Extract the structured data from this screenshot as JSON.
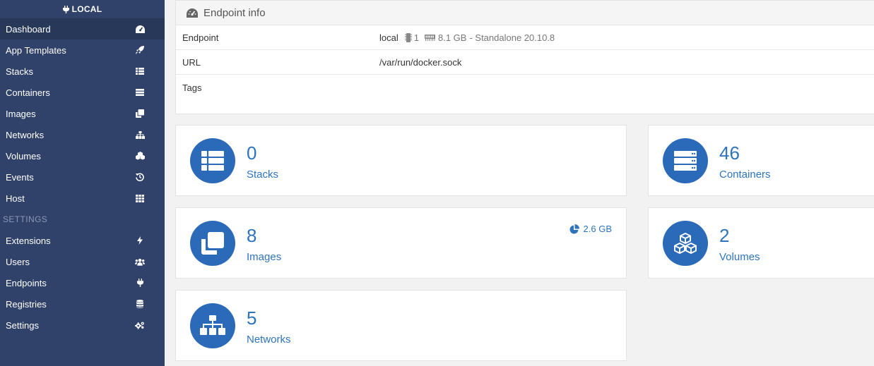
{
  "sidebar": {
    "header": "LOCAL",
    "items": [
      {
        "label": "Dashboard",
        "icon": "dashboard-icon"
      },
      {
        "label": "App Templates",
        "icon": "rocket-icon"
      },
      {
        "label": "Stacks",
        "icon": "list-icon"
      },
      {
        "label": "Containers",
        "icon": "server-icon"
      },
      {
        "label": "Images",
        "icon": "clone-icon"
      },
      {
        "label": "Networks",
        "icon": "sitemap-icon"
      },
      {
        "label": "Volumes",
        "icon": "cubes-icon"
      },
      {
        "label": "Events",
        "icon": "history-icon"
      },
      {
        "label": "Host",
        "icon": "th-icon"
      }
    ],
    "settings_label": "SETTINGS",
    "settings_items": [
      {
        "label": "Extensions",
        "icon": "bolt-icon"
      },
      {
        "label": "Users",
        "icon": "users-icon"
      },
      {
        "label": "Endpoints",
        "icon": "plug-icon"
      },
      {
        "label": "Registries",
        "icon": "database-icon"
      },
      {
        "label": "Settings",
        "icon": "cogs-icon"
      }
    ]
  },
  "endpoint_info": {
    "title": "Endpoint info",
    "endpoint_label": "Endpoint",
    "endpoint_name": "local",
    "cpu": "1",
    "memory": "8.1 GB",
    "mode": "- Standalone 20.10.8",
    "url_label": "URL",
    "url": "/var/run/docker.sock",
    "tags_label": "Tags"
  },
  "tiles": {
    "stacks": {
      "count": "0",
      "label": "Stacks"
    },
    "containers": {
      "count": "46",
      "label": "Containers"
    },
    "images": {
      "count": "8",
      "label": "Images",
      "size": "2.6 GB"
    },
    "volumes": {
      "count": "2",
      "label": "Volumes"
    },
    "networks": {
      "count": "5",
      "label": "Networks"
    }
  },
  "colors": {
    "sidebar_bg": "#30426a",
    "accent": "#2d74bd",
    "circle": "#2a6ab8"
  }
}
